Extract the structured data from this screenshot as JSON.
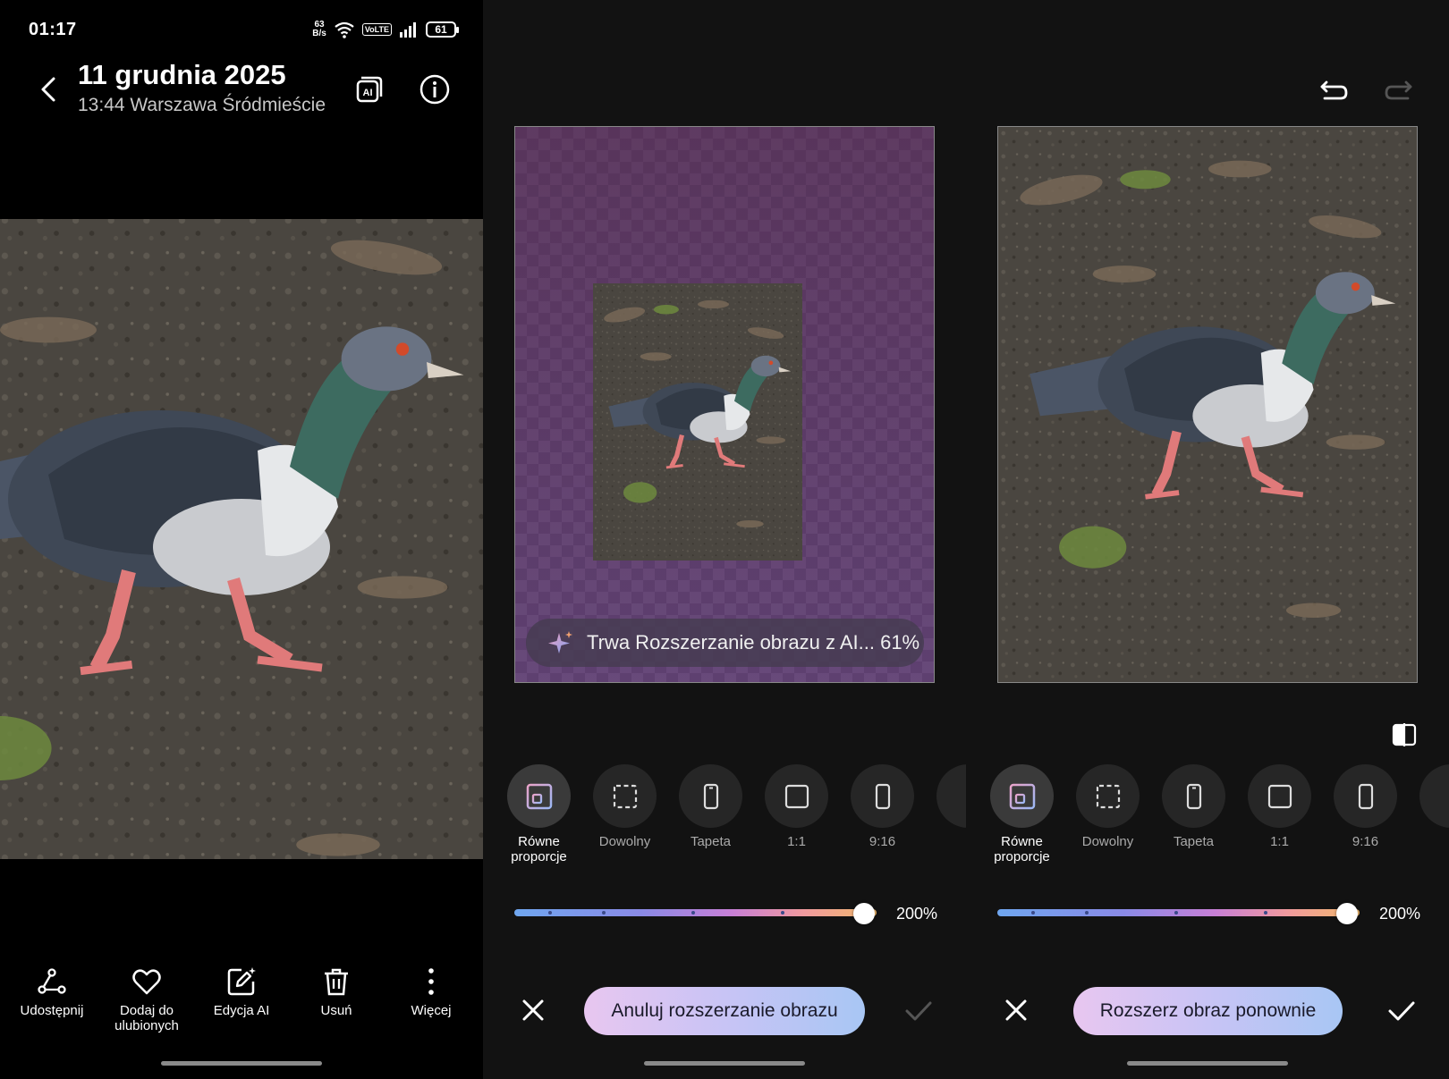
{
  "status_bar": {
    "time": "01:17",
    "net_speed_value": "63",
    "net_speed_unit": "B/s",
    "volte": "VoLTE",
    "battery": "61"
  },
  "viewer": {
    "title": "11 grudnia 2025",
    "subtitle": "13:44 Warszawa Śródmieście",
    "actions": [
      {
        "label": "Udostępnij",
        "icon": "share-icon"
      },
      {
        "label": "Dodaj do ulubionych",
        "icon": "heart-icon"
      },
      {
        "label": "Edycja AI",
        "icon": "ai-edit-icon"
      },
      {
        "label": "Usuń",
        "icon": "trash-icon"
      },
      {
        "label": "Więcej",
        "icon": "more-vertical-icon"
      }
    ]
  },
  "editor_progress": {
    "progress_text": "Trwa Rozszerzanie obrazu z AI... 61%",
    "progress_value": 61,
    "zoom_label": "200%",
    "primary_button": "Anuluj rozszerzanie obrazu"
  },
  "editor_done": {
    "zoom_label": "200%",
    "primary_button": "Rozszerz obraz ponownie"
  },
  "ratio_options": [
    {
      "label": "Równe proporcje",
      "icon": "equal-ratio-icon",
      "selected": true
    },
    {
      "label": "Dowolny",
      "icon": "free-crop-icon",
      "selected": false
    },
    {
      "label": "Tapeta",
      "icon": "wallpaper-phone-icon",
      "selected": false
    },
    {
      "label": "1:1",
      "icon": "square-icon",
      "selected": false
    },
    {
      "label": "9:16",
      "icon": "portrait-ratio-icon",
      "selected": false
    }
  ],
  "colors": {
    "accent_gradient_start": "#e8c6f0",
    "accent_gradient_end": "#a8c6f4",
    "background": "#121212"
  }
}
